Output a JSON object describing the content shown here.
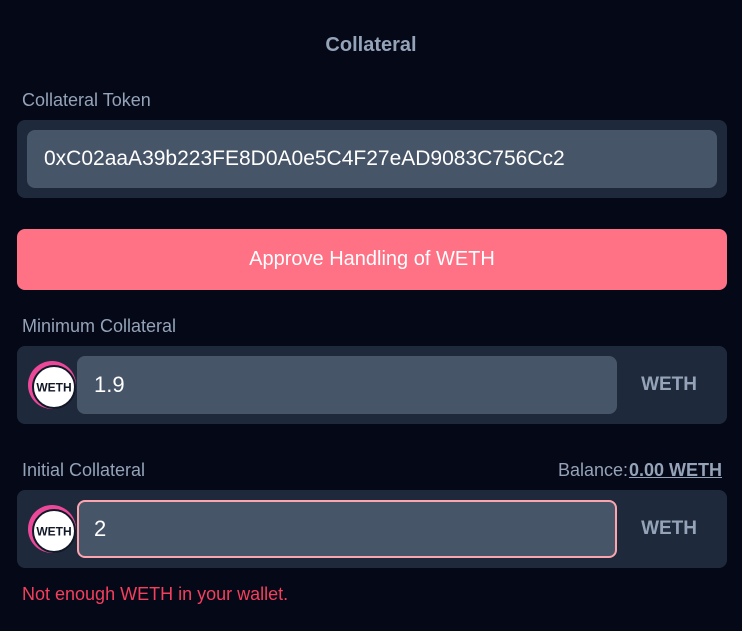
{
  "section": {
    "title": "Collateral"
  },
  "collateral_token": {
    "label": "Collateral Token",
    "value": "0xC02aaA39b223FE8D0A0e5C4F27eAD9083C756Cc2"
  },
  "approve": {
    "label": "Approve Handling of WETH",
    "color": "#ff7185"
  },
  "minimum_collateral": {
    "label": "Minimum Collateral",
    "value": "1.9",
    "unit": "WETH",
    "token_logo_text": "WETH",
    "token_icon": "weth-token-icon"
  },
  "initial_collateral": {
    "label": "Initial Collateral",
    "balance_label": "Balance:",
    "balance_value": "0.00 WETH",
    "value": "2",
    "unit": "WETH",
    "token_logo_text": "WETH",
    "token_icon": "weth-token-icon",
    "error": "Not enough WETH in your wallet.",
    "error_color": "#f43f5e"
  }
}
